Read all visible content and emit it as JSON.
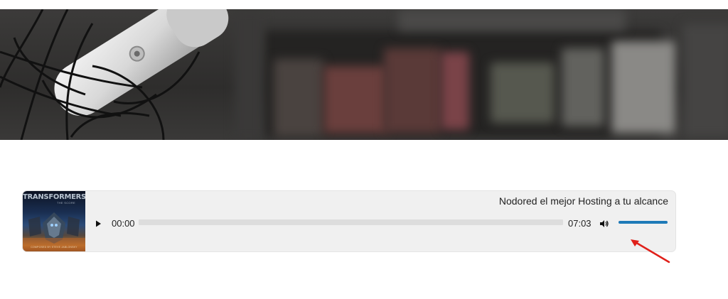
{
  "player": {
    "track_title": "Nodored el mejor Hosting a tu alcance",
    "current_time": "00:00",
    "duration": "07:03",
    "progress": 0,
    "volume": 1.0,
    "play_icon": "play-icon",
    "volume_icon": "volume-icon",
    "accent_color": "#1e7ab8",
    "cover": {
      "title": "TRANSFORMERS",
      "subtitle": "THE SCORE",
      "footer": "COMPOSED BY STEVE JABLONSKY"
    }
  },
  "annotation": {
    "color": "#e0201a"
  }
}
